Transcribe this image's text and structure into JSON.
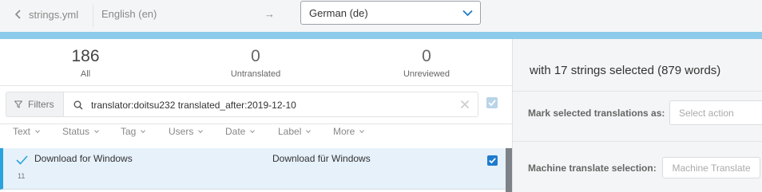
{
  "header": {
    "back_label": "strings.yml",
    "source_language": "English (en)",
    "arrow": "→",
    "target_language": "German (de)"
  },
  "stats": [
    {
      "count": "186",
      "label": "All"
    },
    {
      "count": "0",
      "label": "Untranslated"
    },
    {
      "count": "0",
      "label": "Unreviewed"
    }
  ],
  "filters": {
    "button_label": "Filters",
    "query": "translator:doitsu232 translated_after:2019-12-10"
  },
  "columns": [
    "Text",
    "Status",
    "Tag",
    "Users",
    "Date",
    "Label",
    "More"
  ],
  "rows": [
    {
      "source": "Download for Windows",
      "number": "11",
      "target": "Download für Windows",
      "checked": true
    }
  ],
  "selection": {
    "title": "with 17 strings selected (879 words)",
    "mark_label": "Mark selected translations as:",
    "action_placeholder": "Select action",
    "mt_label": "Machine translate selection:",
    "mt_button": "Machine Translate"
  },
  "colors": {
    "accent": "#29a3dd",
    "progress": "#8ccbe9",
    "checkbox": "#1f7ccc"
  },
  "icons": {
    "back": "chevron-left-icon",
    "dropdown": "chevron-down-icon",
    "filter": "funnel-icon",
    "search": "search-icon",
    "clear": "close-icon",
    "row_status": "checkmark-icon"
  }
}
